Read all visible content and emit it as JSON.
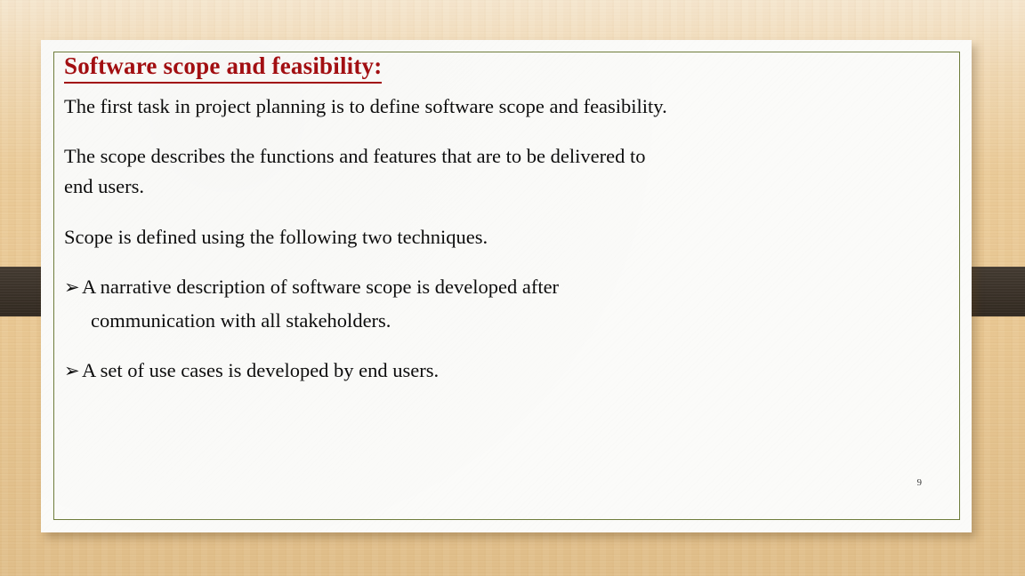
{
  "slide": {
    "title": "Software scope and feasibility:",
    "title_color": "#a20f12",
    "border_color": "#6f7d3c",
    "background_color": "#e9c894",
    "ribbon_color": "#3a3026",
    "number": "9",
    "body": {
      "paragraph_1": "The first task in project planning is to define software scope and feasibility.",
      "paragraph_2": "The scope describes the functions and features that are to be delivered to",
      "paragraph_3": "end users.",
      "paragraph_4": "Scope is defined using the following two techniques."
    },
    "bullets": [
      {
        "marker": "➢",
        "marker_name": "arrowhead-bullet",
        "text": "A  narrative  description  of  software  scope  is  developed  after",
        "continuation": "communication with all stakeholders."
      },
      {
        "marker": "➢",
        "marker_name": "arrowhead-bullet",
        "text": "A set of use cases is developed by end users.",
        "continuation": ""
      }
    ]
  }
}
